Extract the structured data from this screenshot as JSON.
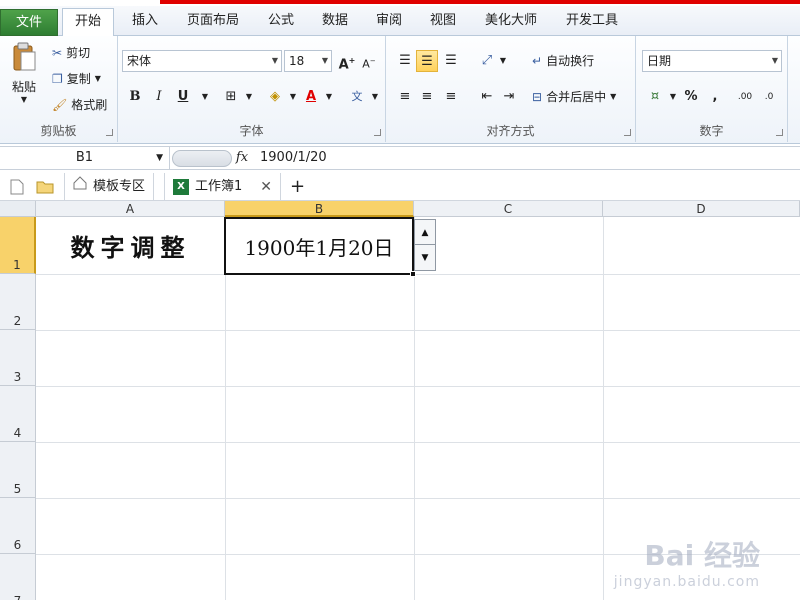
{
  "menu": {
    "file": "文件",
    "tabs": [
      "开始",
      "插入",
      "页面布局",
      "公式",
      "数据",
      "审阅",
      "视图",
      "美化大师",
      "开发工具"
    ]
  },
  "ribbon": {
    "clipboard": {
      "paste": "粘贴",
      "cut": "剪切",
      "copy": "复制",
      "format_painter": "格式刷",
      "label": "剪贴板"
    },
    "font": {
      "name": "宋体",
      "size": "18",
      "bold": "B",
      "italic": "I",
      "underline": "U",
      "label": "字体"
    },
    "alignment": {
      "wrap": "自动换行",
      "merge": "合并后居中",
      "label": "对齐方式"
    },
    "number": {
      "format": "日期",
      "percent": "%",
      "comma": ",",
      "label": "数字"
    }
  },
  "formula_bar": {
    "name_box": "B1",
    "fx": "fx",
    "content": "1900/1/20"
  },
  "doc_tabs": {
    "template": "模板专区",
    "workbook": "工作簿1",
    "add": "+"
  },
  "sheet": {
    "columns": [
      "A",
      "B",
      "C",
      "D"
    ],
    "rows": [
      "1",
      "2",
      "3",
      "4",
      "5",
      "6",
      "7"
    ],
    "cells": {
      "A1": "数字调整",
      "B1": "1900年1月20日"
    },
    "selected": "B1"
  },
  "watermark": {
    "brand": "Bai 经验",
    "url": "jingyan.baidu.com"
  },
  "colors": {
    "file_tab": "#2e7d32",
    "selection": "#f8d26a",
    "top_strip": "#e00000"
  }
}
